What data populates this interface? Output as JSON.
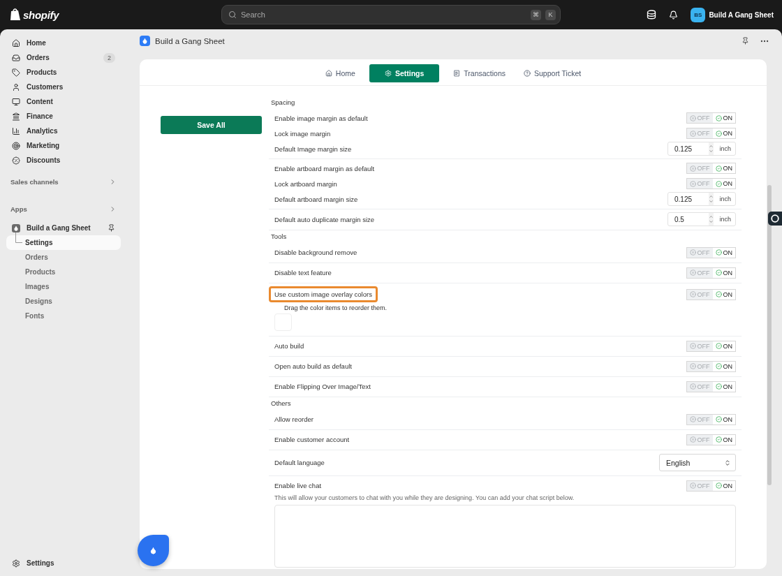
{
  "topbar": {
    "brand": "shopify",
    "search": {
      "placeholder": "Search",
      "keys": [
        "⌘",
        "K"
      ]
    },
    "store": {
      "initials": "BS",
      "name": "Build A Gang Sheet"
    }
  },
  "sidebar": {
    "items": [
      {
        "label": "Home",
        "selected": false
      },
      {
        "label": "Orders",
        "badge": "2",
        "selected": false
      },
      {
        "label": "Products",
        "selected": false
      },
      {
        "label": "Customers",
        "selected": false
      },
      {
        "label": "Content",
        "selected": false
      },
      {
        "label": "Finance",
        "selected": false
      },
      {
        "label": "Analytics",
        "selected": false
      },
      {
        "label": "Marketing",
        "selected": false
      },
      {
        "label": "Discounts",
        "selected": false
      }
    ],
    "sales_channels": "Sales channels",
    "apps": "Apps",
    "app": {
      "label": "Build a Gang Sheet",
      "children": [
        {
          "label": "Settings",
          "selected": true
        },
        {
          "label": "Orders",
          "selected": false
        },
        {
          "label": "Products",
          "selected": false
        },
        {
          "label": "Images",
          "selected": false
        },
        {
          "label": "Designs",
          "selected": false
        },
        {
          "label": "Fonts",
          "selected": false
        }
      ]
    },
    "settings": "Settings"
  },
  "app_header": {
    "title": "Build a Gang Sheet"
  },
  "tabs": [
    {
      "label": "Home",
      "selected": false
    },
    {
      "label": "Settings",
      "selected": true
    },
    {
      "label": "Transactions",
      "selected": false
    },
    {
      "label": "Support Ticket",
      "selected": false
    }
  ],
  "save_button": "Save All",
  "sections": [
    {
      "title": "Spacing",
      "groups": [
        [
          {
            "kind": "toggle",
            "label": "Enable image margin as default",
            "off": "OFF",
            "on_label": "ON",
            "on": true
          },
          {
            "kind": "toggle",
            "label": "Lock image margin",
            "off": "OFF",
            "on_label": "ON",
            "on": true
          },
          {
            "kind": "number",
            "label": "Default Image margin size",
            "value": "0.125",
            "unit": "inch"
          }
        ],
        [
          {
            "kind": "toggle",
            "label": "Enable artboard margin as default",
            "off": "OFF",
            "on_label": "ON",
            "on": true
          },
          {
            "kind": "toggle",
            "label": "Lock artboard margin",
            "off": "OFF",
            "on_label": "ON",
            "on": true
          },
          {
            "kind": "number",
            "label": "Default artboard margin size",
            "value": "0.125",
            "unit": "inch"
          }
        ],
        [
          {
            "kind": "number",
            "label": "Default auto duplicate margin size",
            "value": "0.5",
            "unit": "inch"
          }
        ]
      ]
    },
    {
      "title": "Tools",
      "groups": [
        [
          {
            "kind": "toggle",
            "label": "Disable background remove",
            "off": "OFF",
            "on_label": "ON",
            "on": true
          }
        ],
        [
          {
            "kind": "toggle",
            "label": "Disable text feature",
            "off": "OFF",
            "on_label": "ON",
            "on": true
          }
        ],
        [
          {
            "kind": "colors",
            "label": "Use custom image overlay colors",
            "highlighted": true,
            "off": "OFF",
            "on_label": "ON",
            "on": true,
            "hint": "Drag the color items to reorder them."
          }
        ],
        [
          {
            "kind": "toggle",
            "label": "Auto build",
            "off": "OFF",
            "on_label": "ON",
            "on": true
          }
        ],
        [
          {
            "kind": "toggle",
            "label": "Open auto build as default",
            "off": "OFF",
            "on_label": "ON",
            "on": true
          }
        ],
        [
          {
            "kind": "toggle",
            "label": "Enable Flipping Over Image/Text",
            "off": "OFF",
            "on_label": "ON",
            "on": true
          }
        ]
      ]
    },
    {
      "title": "Others",
      "groups": [
        [
          {
            "kind": "toggle",
            "label": "Allow reorder",
            "off": "OFF",
            "on_label": "ON",
            "on": true
          }
        ],
        [
          {
            "kind": "toggle",
            "label": "Enable customer account",
            "off": "OFF",
            "on_label": "ON",
            "on": true
          }
        ],
        [
          {
            "kind": "select",
            "label": "Default language",
            "value": "English"
          }
        ],
        [
          {
            "kind": "chat",
            "label": "Enable live chat",
            "off": "OFF",
            "on_label": "ON",
            "on": true,
            "hint": "This will allow your customers to chat with you while they are designing. You can add your chat script below."
          }
        ]
      ]
    }
  ]
}
